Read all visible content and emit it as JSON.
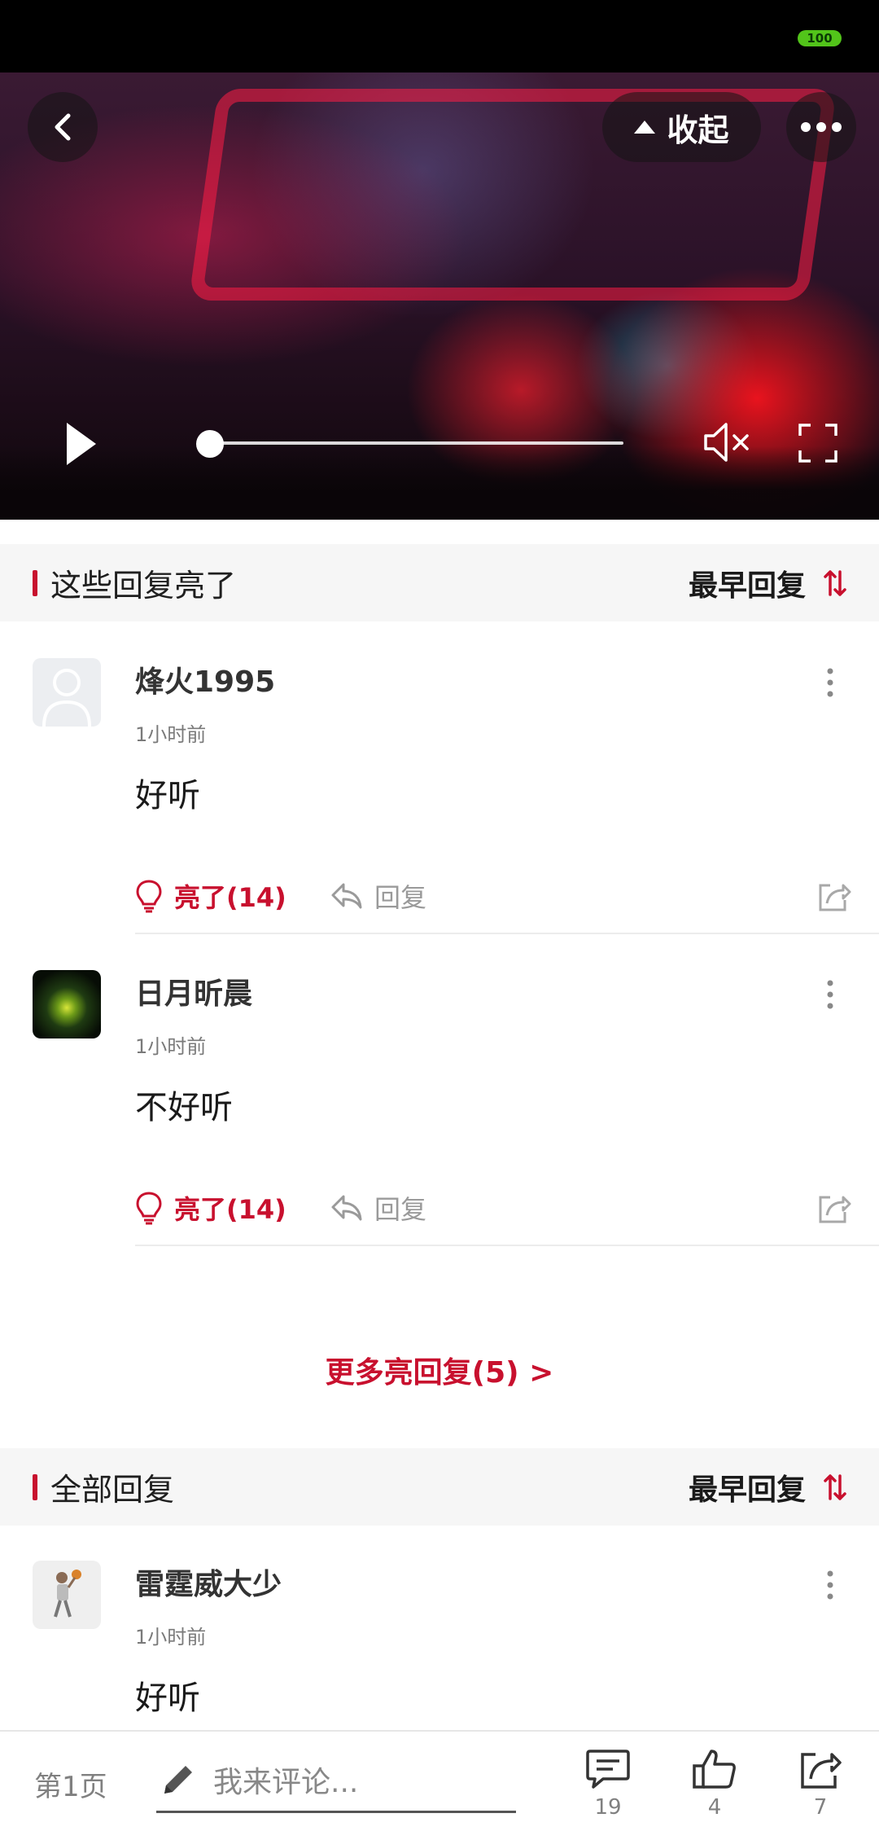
{
  "status_bar": {
    "battery": "100"
  },
  "video": {
    "collapse_label": "收起",
    "progress": 0.0
  },
  "highlight_section": {
    "title": "这些回复亮了",
    "sort_label": "最早回复",
    "comments": [
      {
        "username": "烽火1995",
        "time": "1小时前",
        "text": "好听",
        "light_label": "亮了(14)",
        "reply_label": "回复"
      },
      {
        "username": "日月昕晨",
        "time": "1小时前",
        "text": "不好听",
        "light_label": "亮了(14)",
        "reply_label": "回复"
      }
    ],
    "more_link": "更多亮回复(5) >"
  },
  "all_section": {
    "title": "全部回复",
    "sort_label": "最早回复",
    "comments": [
      {
        "username": "雷霆威大少",
        "time": "1小时前",
        "text": "好听"
      }
    ]
  },
  "bottom_bar": {
    "page_label": "第1页",
    "input_placeholder": "我来评论...",
    "comment_count": "19",
    "like_count": "4",
    "share_count": "7"
  },
  "colors": {
    "accent": "#c8102e",
    "battery": "#52c41a"
  }
}
